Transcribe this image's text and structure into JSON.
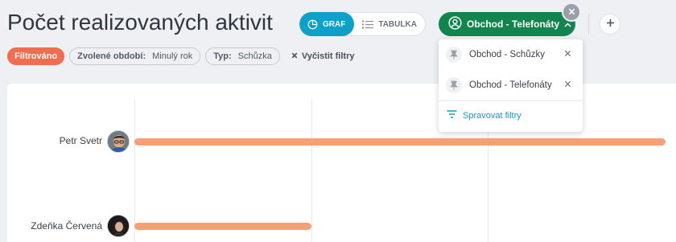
{
  "header": {
    "title": "Počet realizovaných aktivit",
    "view_toggle": {
      "graph_label": "GRAF",
      "table_label": "TABULKA",
      "active": "graph"
    },
    "filter_select": {
      "label": "Obchod - Telefonáty"
    }
  },
  "filters": {
    "filtered_label": "Filtrováno",
    "period": {
      "key": "Zvolené období:",
      "value": "Minulý rok"
    },
    "type": {
      "key": "Typ:",
      "value": "Schůzka"
    },
    "clear_label": "Vyčistit filtry"
  },
  "dropdown": {
    "items": [
      {
        "label": "Obchod - Schůzky"
      },
      {
        "label": "Obchod - Telefonáty"
      }
    ],
    "manage_label": "Spravovat filtry"
  },
  "chart_data": {
    "type": "bar",
    "orientation": "horizontal",
    "categories": [
      "Petr Svetr",
      "Zdeňka Červená"
    ],
    "values": [
      3,
      1
    ],
    "xlim": [
      0,
      3
    ],
    "grid": true,
    "bar_color": "#f7a077"
  },
  "colors": {
    "accent_blue": "#0da0c9",
    "accent_green": "#12854f",
    "filtered_badge": "#f26c4f"
  }
}
